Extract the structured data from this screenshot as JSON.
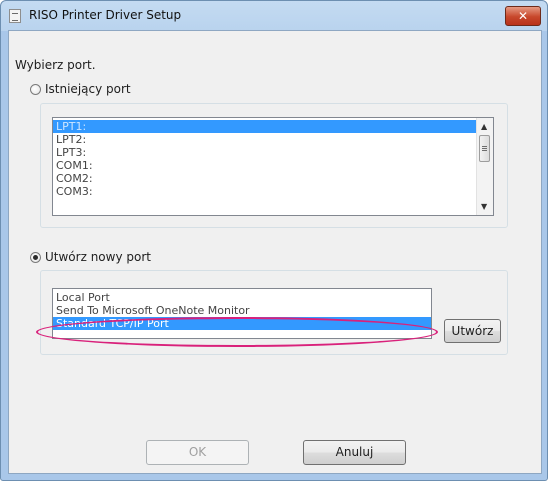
{
  "window": {
    "title": "RISO Printer Driver Setup",
    "close_label": "✕"
  },
  "instruction": "Wybierz port.",
  "existing_port": {
    "label": "Istniejący port",
    "selected": false,
    "items": [
      "LPT1:",
      "LPT2:",
      "LPT3:",
      "COM1:",
      "COM2:",
      "COM3:"
    ],
    "selected_index": 0
  },
  "new_port": {
    "label": "Utwórz nowy port",
    "selected": true,
    "items": [
      "Local Port",
      "Send To Microsoft OneNote Monitor",
      "Standard TCP/IP Port"
    ],
    "selected_index": 2,
    "create_button": "Utwórz"
  },
  "buttons": {
    "ok": "OK",
    "cancel": "Anuluj"
  },
  "colors": {
    "selection": "#3399ff",
    "highlight_ellipse": "#d9217b"
  }
}
